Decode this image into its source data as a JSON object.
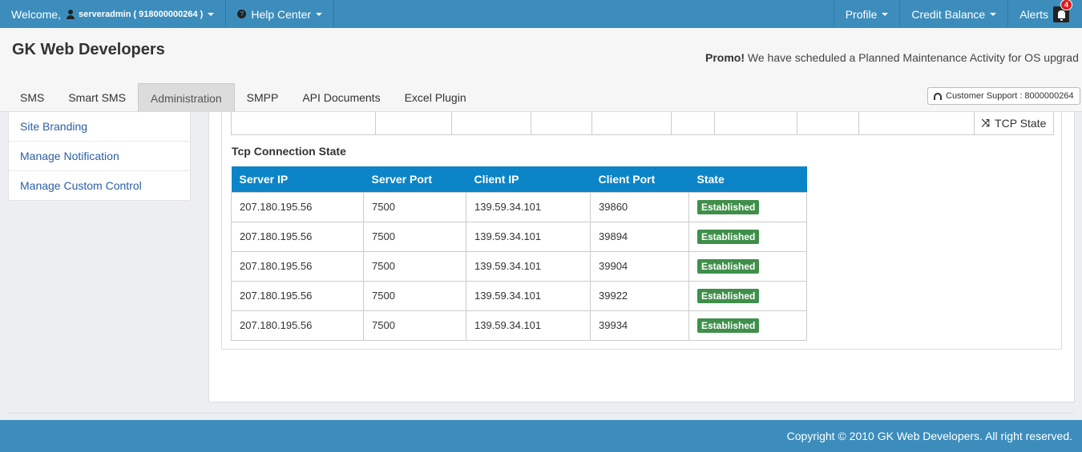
{
  "topbar": {
    "welcome_label": "Welcome,",
    "username": "serveradmin ( 918000000264 )",
    "help_center": "Help Center",
    "profile": "Profile",
    "credit_balance": "Credit Balance",
    "alerts": "Alerts",
    "alerts_count": "4"
  },
  "header": {
    "brand": "GK Web Developers",
    "promo_label": "Promo!",
    "promo_text": "We have scheduled a Planned Maintenance Activity for OS upgrad",
    "support": "Customer Support : 8000000264"
  },
  "nav": {
    "tabs": [
      "SMS",
      "Smart SMS",
      "Administration",
      "SMPP",
      "API Documents",
      "Excel Plugin"
    ]
  },
  "sidebar": {
    "items": [
      "Site Branding",
      "Manage Notification",
      "Manage Custom Control"
    ]
  },
  "main": {
    "tcp_state_button": "TCP State",
    "section_title": "Tcp Connection State",
    "columns": [
      "Server IP",
      "Server Port",
      "Client IP",
      "Client Port",
      "State"
    ],
    "rows": [
      [
        "207.180.195.56",
        "7500",
        "139.59.34.101",
        "39860",
        "Established"
      ],
      [
        "207.180.195.56",
        "7500",
        "139.59.34.101",
        "39894",
        "Established"
      ],
      [
        "207.180.195.56",
        "7500",
        "139.59.34.101",
        "39904",
        "Established"
      ],
      [
        "207.180.195.56",
        "7500",
        "139.59.34.101",
        "39922",
        "Established"
      ],
      [
        "207.180.195.56",
        "7500",
        "139.59.34.101",
        "39934",
        "Established"
      ]
    ]
  },
  "footer": {
    "copyright": "Copyright © 2010 GK Web Developers. All right reserved."
  },
  "colors": {
    "topbar": "#3c8dbc",
    "table_header": "#0b85c7",
    "established_badge": "#3f8f4a",
    "alert_badge": "#dd1a1a"
  }
}
